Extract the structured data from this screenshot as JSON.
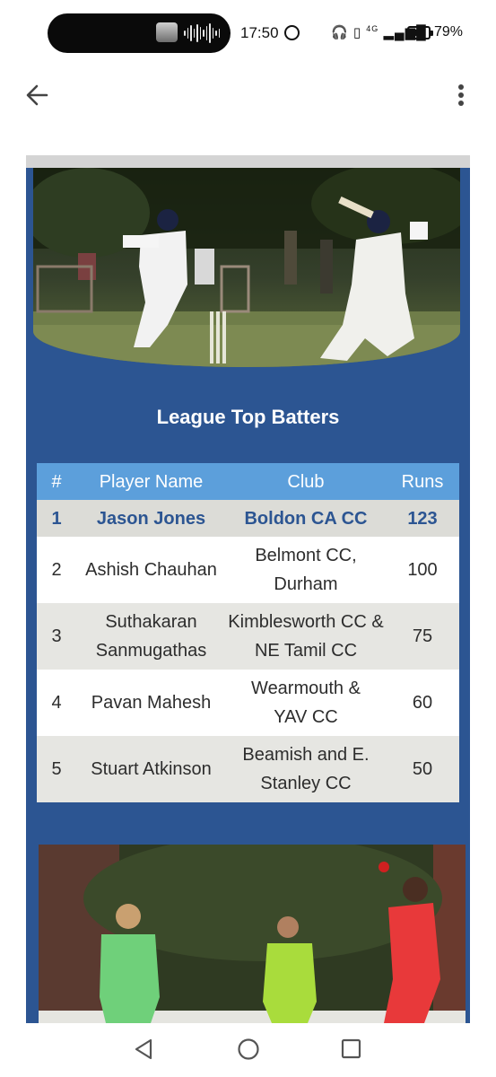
{
  "status_bar": {
    "time": "17:50",
    "signal_text": "4G",
    "battery_percent": "79%",
    "battery_level": 0.79,
    "icons": [
      "whatsapp-icon",
      "headphones-icon",
      "battery-saver-icon",
      "vibrate-icon",
      "signal-icon",
      "battery-icon"
    ]
  },
  "app_bar": {
    "back_icon": "arrow-left-icon",
    "menu_icon": "more-vertical-icon"
  },
  "card": {
    "title": "League Top Batters",
    "colors": {
      "background": "#2c5592",
      "header": "#5c9fdb",
      "highlight_text": "#2c5592"
    },
    "table": {
      "columns": [
        "#",
        "Player Name",
        "Club",
        "Runs"
      ],
      "rows": [
        {
          "rank": "1",
          "player": "Jason Jones",
          "club": "Boldon CA CC",
          "runs": "123"
        },
        {
          "rank": "2",
          "player": "Ashish Chauhan",
          "club": "Belmont CC, Durham",
          "runs": "100"
        },
        {
          "rank": "3",
          "player": "Suthakaran Sanmugathas",
          "club": "Kimblesworth CC & NE Tamil CC",
          "runs": "75"
        },
        {
          "rank": "4",
          "player": "Pavan Mahesh",
          "club": "Wearmouth & YAV CC",
          "runs": "60"
        },
        {
          "rank": "5",
          "player": "Stuart Atkinson",
          "club": "Beamish and E. Stanley CC",
          "runs": "50"
        }
      ]
    }
  },
  "nav_bar": {
    "icons": [
      "back-triangle-icon",
      "home-circle-icon",
      "recents-square-icon"
    ]
  }
}
